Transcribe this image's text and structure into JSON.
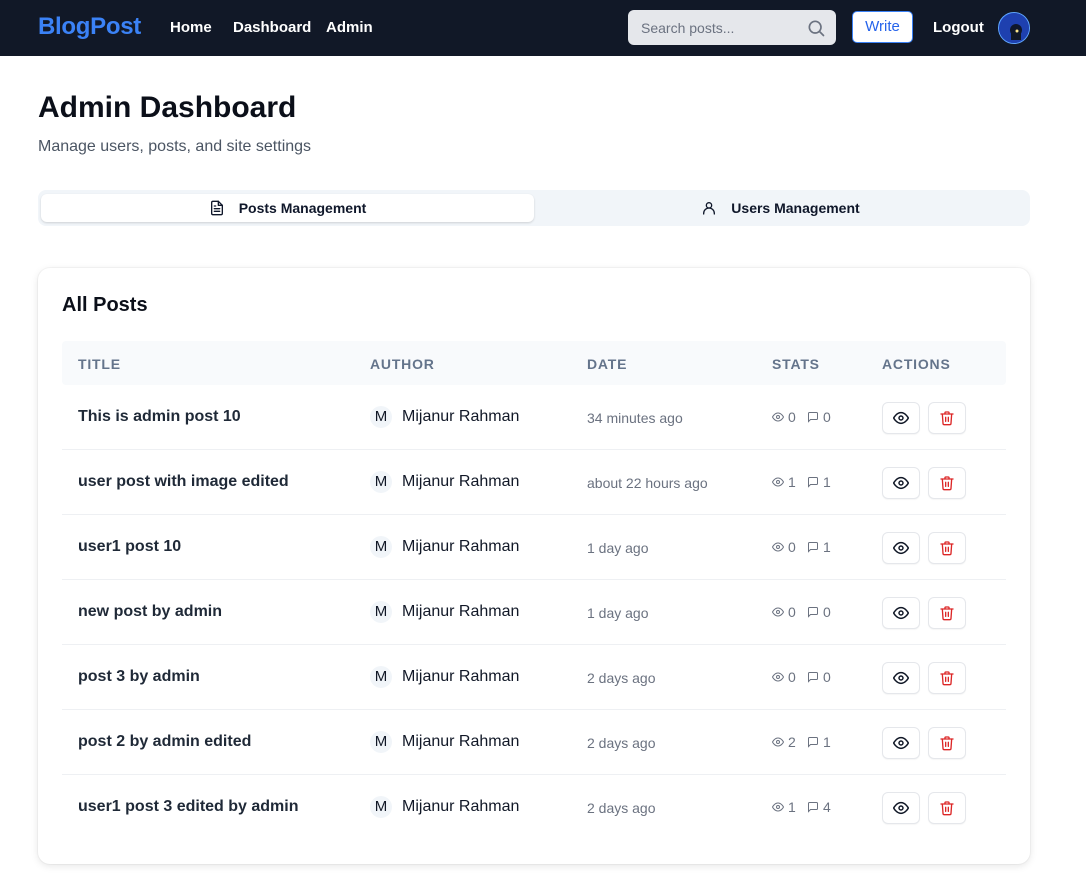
{
  "navbar": {
    "brand": "BlogPost",
    "links": [
      "Home",
      "Dashboard",
      "Admin"
    ],
    "search_placeholder": "Search posts...",
    "write_label": "Write",
    "logout_label": "Logout"
  },
  "header": {
    "title": "Admin Dashboard",
    "subtitle": "Manage users, posts, and site settings"
  },
  "tabs": [
    {
      "label": "Posts Management",
      "icon": "file-text-icon",
      "active": true
    },
    {
      "label": "Users Management",
      "icon": "user-icon",
      "active": false
    }
  ],
  "posts_card": {
    "title": "All Posts",
    "columns": [
      "TITLE",
      "AUTHOR",
      "DATE",
      "STATS",
      "ACTIONS"
    ],
    "rows": [
      {
        "title": "This is admin post 10",
        "author_initial": "M",
        "author": "Mijanur Rahman",
        "date": "34 minutes ago",
        "views": "0",
        "comments": "0"
      },
      {
        "title": "user post with image edited",
        "author_initial": "M",
        "author": "Mijanur Rahman",
        "date": "about 22 hours ago",
        "views": "1",
        "comments": "1"
      },
      {
        "title": "user1 post 10",
        "author_initial": "M",
        "author": "Mijanur Rahman",
        "date": "1 day ago",
        "views": "0",
        "comments": "1"
      },
      {
        "title": "new post by admin",
        "author_initial": "M",
        "author": "Mijanur Rahman",
        "date": "1 day ago",
        "views": "0",
        "comments": "0"
      },
      {
        "title": "post 3 by admin",
        "author_initial": "M",
        "author": "Mijanur Rahman",
        "date": "2 days ago",
        "views": "0",
        "comments": "0"
      },
      {
        "title": "post 2 by admin edited",
        "author_initial": "M",
        "author": "Mijanur Rahman",
        "date": "2 days ago",
        "views": "2",
        "comments": "1"
      },
      {
        "title": "user1 post 3 edited by admin",
        "author_initial": "M",
        "author": "Mijanur Rahman",
        "date": "2 days ago",
        "views": "1",
        "comments": "4"
      }
    ]
  },
  "colors": {
    "navbar_bg": "#111827",
    "brand": "#3b82f6",
    "delete": "#dc2626"
  }
}
